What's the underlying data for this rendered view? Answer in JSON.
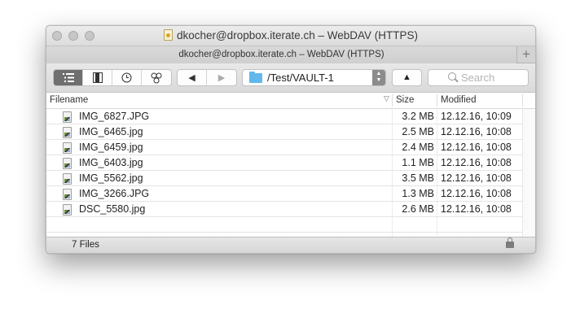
{
  "window": {
    "title": "dkocher@dropbox.iterate.ch – WebDAV (HTTPS)"
  },
  "tabs": [
    {
      "label": "dkocher@dropbox.iterate.ch – WebDAV (HTTPS)"
    }
  ],
  "tab_add_label": "+",
  "toolbar": {
    "view_buttons": [
      {
        "icon": "browser-list-icon",
        "active": true
      },
      {
        "icon": "bookmarks-icon",
        "active": false
      },
      {
        "icon": "history-icon",
        "active": false
      },
      {
        "icon": "bonjour-icon",
        "active": false
      }
    ],
    "back_label": "◀",
    "forward_label": "▶",
    "path": "/Test/VAULT-1",
    "up_label": "▲",
    "search_placeholder": "Search"
  },
  "columns": {
    "filename": "Filename",
    "size": "Size",
    "modified": "Modified"
  },
  "files": [
    {
      "name": "IMG_6827.JPG",
      "size": "3.2 MB",
      "modified": "12.12.16, 10:09"
    },
    {
      "name": "IMG_6465.jpg",
      "size": "2.5 MB",
      "modified": "12.12.16, 10:08"
    },
    {
      "name": "IMG_6459.jpg",
      "size": "2.4 MB",
      "modified": "12.12.16, 10:08"
    },
    {
      "name": "IMG_6403.jpg",
      "size": "1.1 MB",
      "modified": "12.12.16, 10:08"
    },
    {
      "name": "IMG_5562.jpg",
      "size": "3.5 MB",
      "modified": "12.12.16, 10:08"
    },
    {
      "name": "IMG_3266.JPG",
      "size": "1.3 MB",
      "modified": "12.12.16, 10:08"
    },
    {
      "name": "DSC_5580.jpg",
      "size": "2.6 MB",
      "modified": "12.12.16, 10:08"
    }
  ],
  "status": {
    "text": "7 Files"
  },
  "colors": {
    "folder": "#62b8ea",
    "active_segment": "#6f6f6f"
  }
}
